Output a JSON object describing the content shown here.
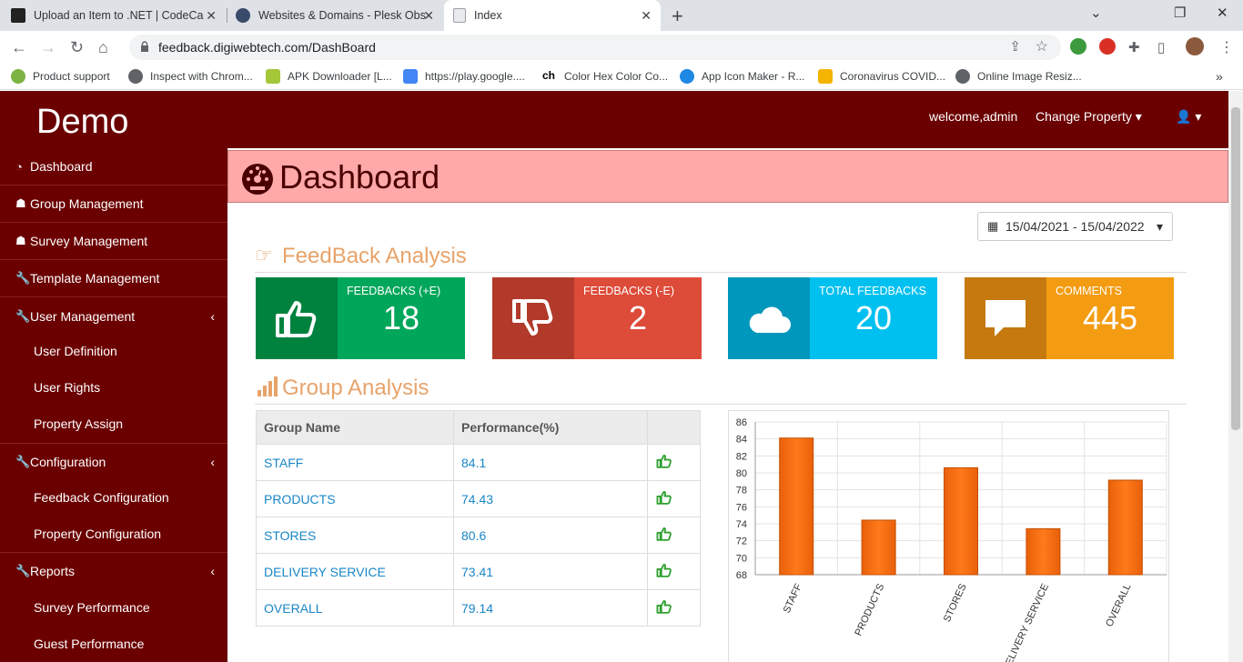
{
  "browser": {
    "tabs": [
      {
        "title": "Upload an Item to .NET | CodeCa"
      },
      {
        "title": "Websites & Domains - Plesk Obs"
      },
      {
        "title": "Index"
      }
    ],
    "url": "feedback.digiwebtech.com/DashBoard",
    "bookmarks": [
      "Product support",
      "Inspect with Chrom...",
      "APK Downloader [L...",
      "https://play.google....",
      "Color Hex Color Co...",
      "App Icon Maker - R...",
      "Coronavirus COVID...",
      "Online Image Resiz..."
    ]
  },
  "app": {
    "brand": "Demo",
    "welcome": "welcome,admin",
    "change_property": "Change Property"
  },
  "sidebar": {
    "items": [
      {
        "label": "Dashboard",
        "icon": "dashboard-icon"
      },
      {
        "label": "Group Management",
        "icon": "sitemap-icon"
      },
      {
        "label": "Survey Management",
        "icon": "sitemap-icon"
      },
      {
        "label": "Template Management",
        "icon": "wrench-icon"
      },
      {
        "label": "User Management",
        "icon": "wrench-icon"
      },
      {
        "label": "Configuration",
        "icon": "wrench-icon"
      },
      {
        "label": "Reports",
        "icon": "wrench-icon"
      }
    ],
    "user_sub": [
      "User Definition",
      "User Rights",
      "Property Assign"
    ],
    "config_sub": [
      "Feedback Configuration",
      "Property Configuration"
    ],
    "reports_sub": [
      "Survey Performance",
      "Guest Performance"
    ]
  },
  "dashboard": {
    "title": "Dashboard",
    "date_range": "15/04/2021 - 15/04/2022",
    "feedback_title": "FeedBack Analysis",
    "group_title": "Group Analysis",
    "boxes": [
      {
        "label": "FEEDBACKS (+E)",
        "value": "18",
        "color_dark": "#00823f",
        "color": "#00a65a"
      },
      {
        "label": "FEEDBACKS (-E)",
        "value": "2",
        "color_dark": "#b13a2a",
        "color": "#dd4b39"
      },
      {
        "label": "TOTAL FEEDBACKS",
        "value": "20",
        "color_dark": "#0097bc",
        "color": "#00c0ef"
      },
      {
        "label": "COMMENTS",
        "value": "445",
        "color_dark": "#c5790f",
        "color": "#f39c12"
      }
    ],
    "table": {
      "headers": [
        "Group Name",
        "Performance(%)"
      ],
      "rows": [
        {
          "name": "STAFF",
          "perf": "84.1"
        },
        {
          "name": "PRODUCTS",
          "perf": "74.43"
        },
        {
          "name": "STORES",
          "perf": "80.6"
        },
        {
          "name": "DELIVERY SERVICE",
          "perf": "73.41"
        },
        {
          "name": "OVERALL",
          "perf": "79.14"
        }
      ]
    }
  },
  "chart_data": {
    "type": "bar",
    "categories": [
      "STAFF",
      "PRODUCTS",
      "STORES",
      "DELIVERY SERVICE",
      "OVERALL"
    ],
    "values": [
      84.1,
      74.43,
      80.6,
      73.41,
      79.14
    ],
    "ylim": [
      68,
      86
    ],
    "yticks": [
      68,
      70,
      72,
      74,
      76,
      78,
      80,
      82,
      84,
      86
    ],
    "color": "#ff7a1a",
    "grid": true
  }
}
